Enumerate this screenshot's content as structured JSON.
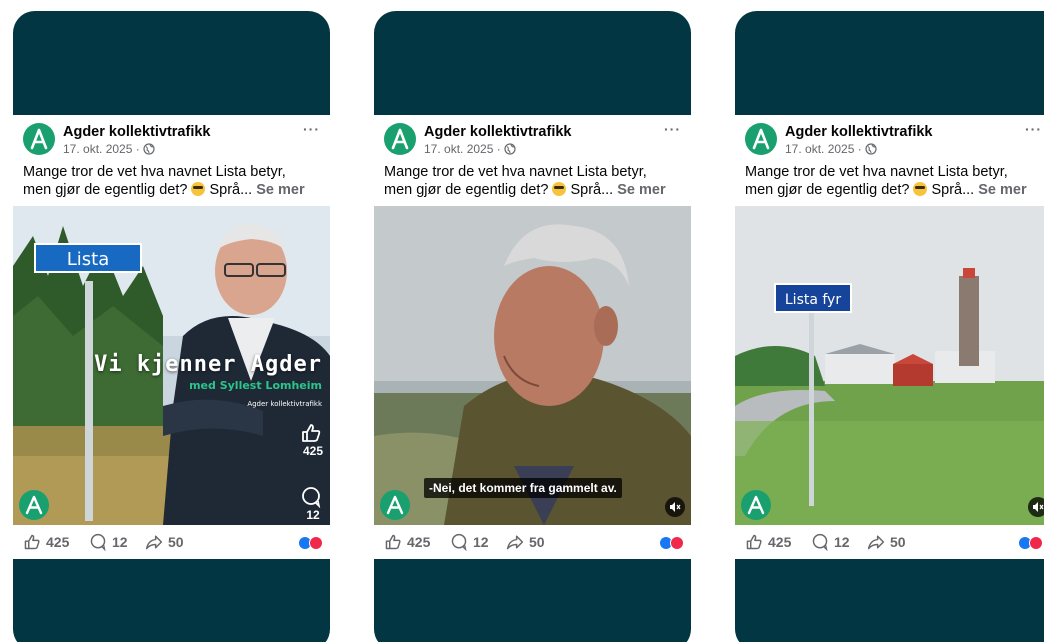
{
  "posts": [
    {
      "author": "Agder kollektivtrafikk",
      "date": "17. okt. 2025 ·",
      "caption_line1": "Mange tror de vet hva navnet Lista betyr,",
      "caption_line2": "men gjør de egentlig det?",
      "caption_trunc": " Språ...",
      "see_more": "Se mer",
      "likes": "425",
      "comments": "12",
      "shares": "50",
      "media": {
        "sign_text": "Lista",
        "title": "Vi kjenner Agder",
        "subtitle": "med Syllest Lomheim",
        "brand": "Agder kollektivtrafikk",
        "side_likes": "425",
        "side_comments": "12"
      }
    },
    {
      "author": "Agder kollektivtrafikk",
      "date": "17. okt. 2025 ·",
      "caption_line1": "Mange tror de vet hva navnet Lista betyr,",
      "caption_line2": "men gjør de egentlig det?",
      "caption_trunc": " Språ...",
      "see_more": "Se mer",
      "likes": "425",
      "comments": "12",
      "shares": "50",
      "media": {
        "subtitle_caption": "-Nei, det kommer fra gammelt av."
      }
    },
    {
      "author": "Agder kollektivtrafikk",
      "date": "17. okt. 2025 ·",
      "caption_line1": "Mange tror de vet hva navnet Lista betyr,",
      "caption_line2": "men gjør de egentlig det?",
      "caption_trunc": " Språ...",
      "see_more": "Se mer",
      "likes": "425",
      "comments": "12",
      "shares": "50",
      "media": {
        "sign_text": "Lista fyr"
      }
    }
  ],
  "icons": {
    "avatar": "agder-logo-icon",
    "more": "more-options-icon",
    "globe": "globe-icon",
    "like": "like-icon",
    "comment": "comment-icon",
    "share": "share-icon",
    "mute": "mute-icon"
  },
  "colors": {
    "card_bg": "#023642",
    "brand_green": "#1aa06e",
    "like_blue": "#1877f2",
    "love_red": "#f0284a"
  }
}
